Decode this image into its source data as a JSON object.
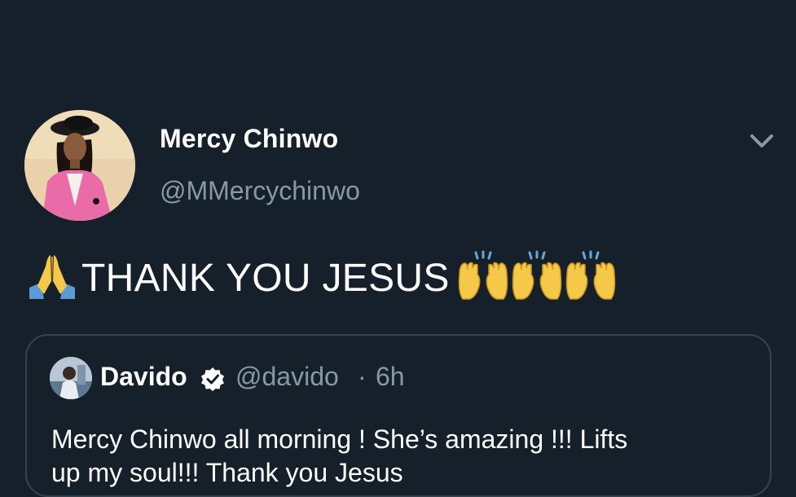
{
  "tweet": {
    "display_name": "Mercy Chinwo",
    "handle": "@MMercychinwo",
    "text": "THANK YOU JESUS",
    "leading_emoji": "folded-hands",
    "trailing_emoji": [
      "raising-hands",
      "raising-hands",
      "raising-hands"
    ],
    "menu_icon": "chevron-down-icon"
  },
  "quoted": {
    "display_name": "Davido",
    "verified": true,
    "handle": "@davido",
    "separator": "·",
    "time": "6h",
    "text": "Mercy Chinwo all morning ! She’s amazing !!! Lifts",
    "text_line2": "up my soul!!! Thank you Jesus"
  },
  "colors": {
    "background": "#15202b",
    "primary_text": "#ffffff",
    "secondary_text": "#8899a6",
    "border": "#38444d",
    "verified_badge": "#ffffff"
  }
}
